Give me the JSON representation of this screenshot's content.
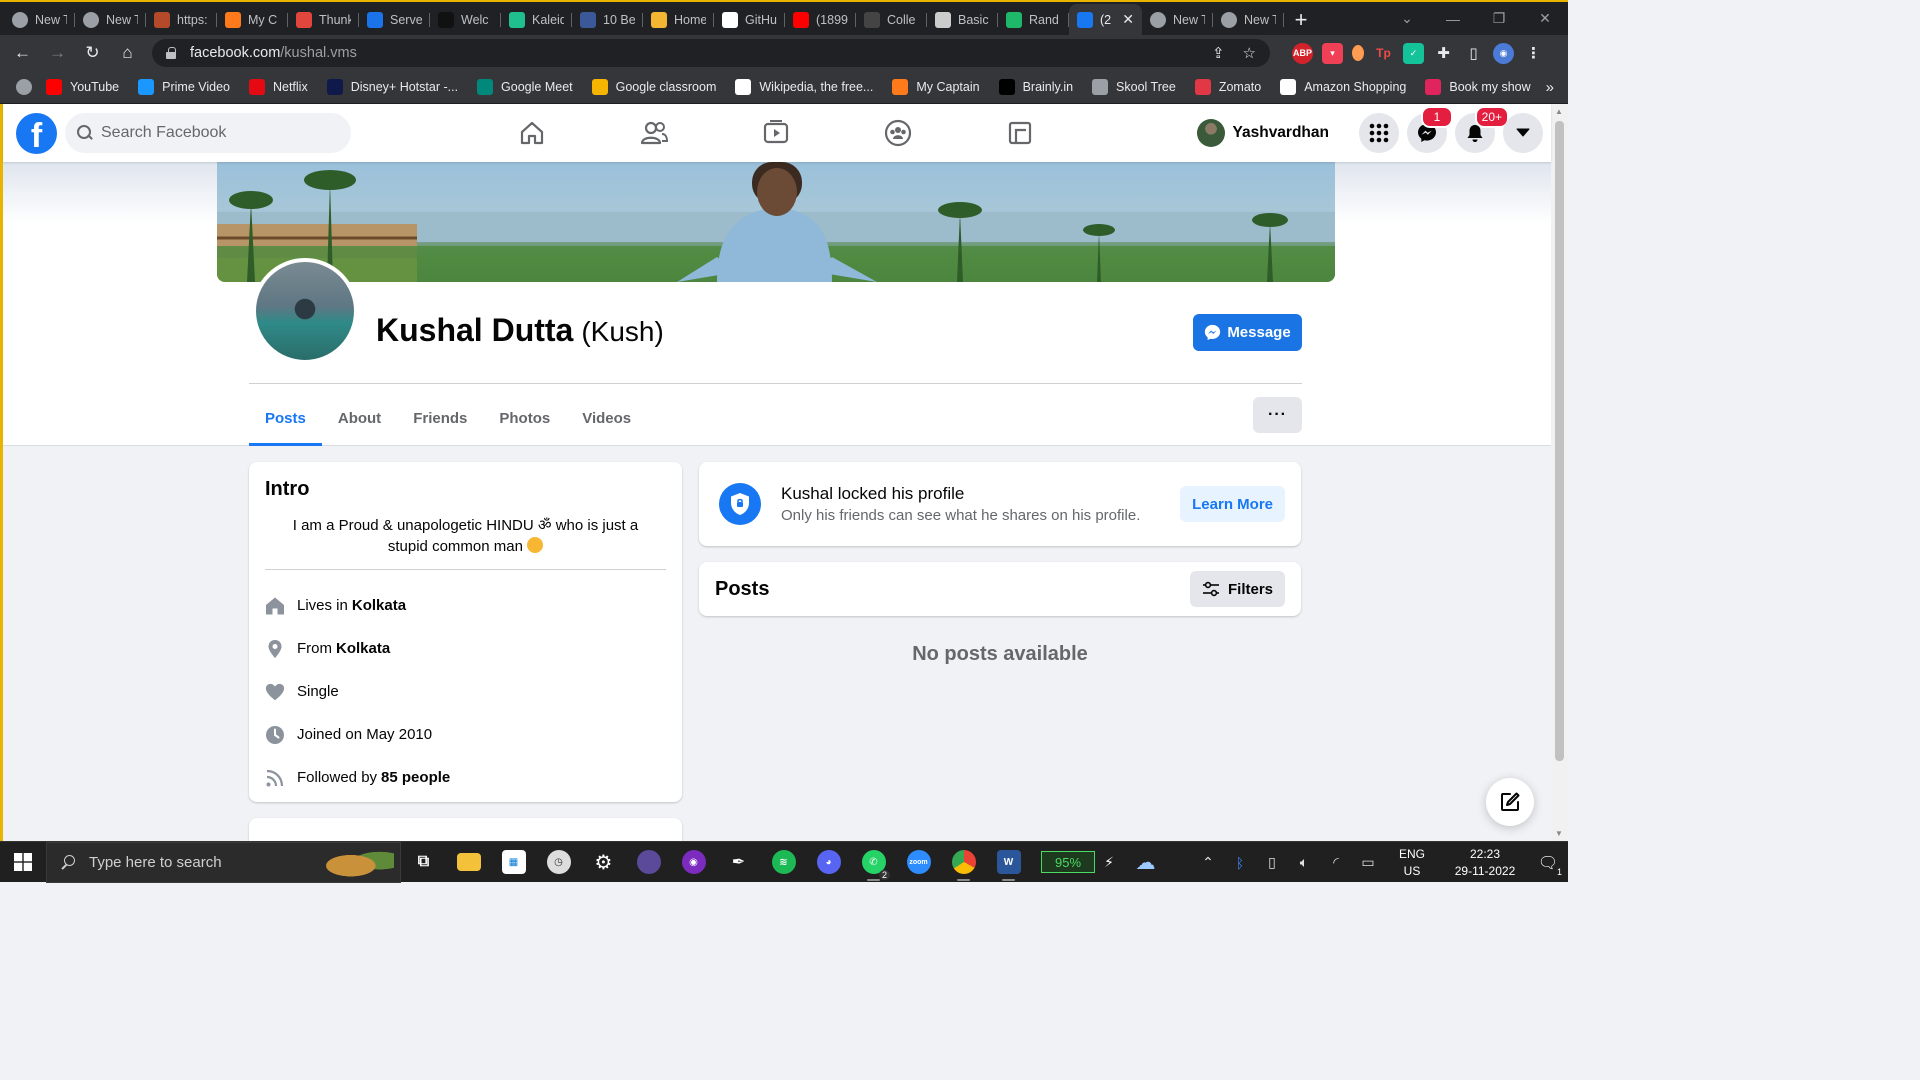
{
  "browser": {
    "tabs": [
      {
        "title": "New T",
        "favicon": "chrome-icon",
        "color": "#5f6368"
      },
      {
        "title": "New T",
        "favicon": "chrome-icon",
        "color": "#5f6368"
      },
      {
        "title": "https:",
        "favicon": "link-icon",
        "color": "#b44a2a"
      },
      {
        "title": "My C",
        "favicon": "mycaptain-icon",
        "color": "#ff7a1a"
      },
      {
        "title": "Thunk",
        "favicon": "thunk-icon",
        "color": "#e0463c"
      },
      {
        "title": "Serve",
        "favicon": "server-icon",
        "color": "#1a73e8"
      },
      {
        "title": "Welc",
        "favicon": "hackerearth-icon",
        "color": "#111111"
      },
      {
        "title": "Kaleid",
        "favicon": "kaleido-icon",
        "color": "#1fbf8f"
      },
      {
        "title": "10 Be",
        "favicon": "link-icon",
        "color": "#3b5998"
      },
      {
        "title": "Home",
        "favicon": "home-icon",
        "color": "#f2b632"
      },
      {
        "title": "GitHu",
        "favicon": "github-icon",
        "color": "#ffffff"
      },
      {
        "title": "(1899",
        "favicon": "youtube-icon",
        "color": "#ff0000"
      },
      {
        "title": "Colle",
        "favicon": "bird-icon",
        "color": "#444444"
      },
      {
        "title": "Basic",
        "favicon": "diamond-icon",
        "color": "#cccccc"
      },
      {
        "title": "Rand",
        "favicon": "r-icon",
        "color": "#1fb76a"
      },
      {
        "title": "(2",
        "favicon": "facebook-icon",
        "color": "#1877f2",
        "active": true
      },
      {
        "title": "New T",
        "favicon": "chrome-icon",
        "color": "#5f6368"
      },
      {
        "title": "New T",
        "favicon": "chrome-icon",
        "color": "#5f6368"
      }
    ],
    "new_tab": "+",
    "url_host": "facebook.com",
    "url_path": "/kushal.vms",
    "bookmarks": [
      {
        "label": "YouTube",
        "icon": "youtube-icon",
        "color": "#ff0000"
      },
      {
        "label": "Prime Video",
        "icon": "prime-video-icon",
        "color": "#1a98ff"
      },
      {
        "label": "Netflix",
        "icon": "netflix-icon",
        "color": "#e50914"
      },
      {
        "label": "Disney+ Hotstar -...",
        "icon": "hotstar-icon",
        "color": "#0f1a4a"
      },
      {
        "label": "Google Meet",
        "icon": "meet-icon",
        "color": "#00897b"
      },
      {
        "label": "Google classroom",
        "icon": "classroom-icon",
        "color": "#f4b400"
      },
      {
        "label": "Wikipedia, the free...",
        "icon": "wikipedia-icon",
        "color": "#ffffff"
      },
      {
        "label": "My Captain",
        "icon": "mycaptain-icon",
        "color": "#ff7a1a"
      },
      {
        "label": "Brainly.in",
        "icon": "brainly-icon",
        "color": "#000000"
      },
      {
        "label": "Skool Tree",
        "icon": "globe-icon",
        "color": "#9aa0a6"
      },
      {
        "label": "Zomato",
        "icon": "zomato-icon",
        "color": "#e23744"
      },
      {
        "label": "Amazon Shopping",
        "icon": "amazon-icon",
        "color": "#ffffff"
      },
      {
        "label": "Book my show",
        "icon": "bookmyshow-icon",
        "color": "#e0245e"
      }
    ]
  },
  "facebook": {
    "search_placeholder": "Search Facebook",
    "user_name": "Yashvardhan",
    "messenger_badge": "1",
    "notifications_badge": "20+",
    "profile": {
      "name": "Kushal Dutta",
      "nickname": "(Kush)",
      "message_label": "Message",
      "tabs": [
        "Posts",
        "About",
        "Friends",
        "Photos",
        "Videos"
      ],
      "active_tab": "Posts",
      "more_label": "···"
    },
    "intro": {
      "title": "Intro",
      "bio": "I am a Proud & unapologetic HINDU ॐ who is just a stupid common man",
      "lives_prefix": "Lives in",
      "lives_city": "Kolkata",
      "from_prefix": "From",
      "from_city": "Kolkata",
      "relationship": "Single",
      "joined": "Joined on May 2010",
      "followed_prefix": "Followed by",
      "followed_count": "85 people"
    },
    "locked": {
      "title": "Kushal locked his profile",
      "subtitle": "Only his friends can see what he shares on his profile.",
      "learn_more": "Learn More"
    },
    "posts": {
      "title": "Posts",
      "filters_label": "Filters",
      "empty_text": "No posts available"
    },
    "accent": "#1877f2"
  },
  "taskbar": {
    "search_placeholder": "Type here to search",
    "battery": "95%",
    "whatsapp_badge": "2",
    "lang_top": "ENG",
    "lang_bottom": "US",
    "time": "22:23",
    "date": "29-11-2022",
    "notification_count": "1"
  }
}
